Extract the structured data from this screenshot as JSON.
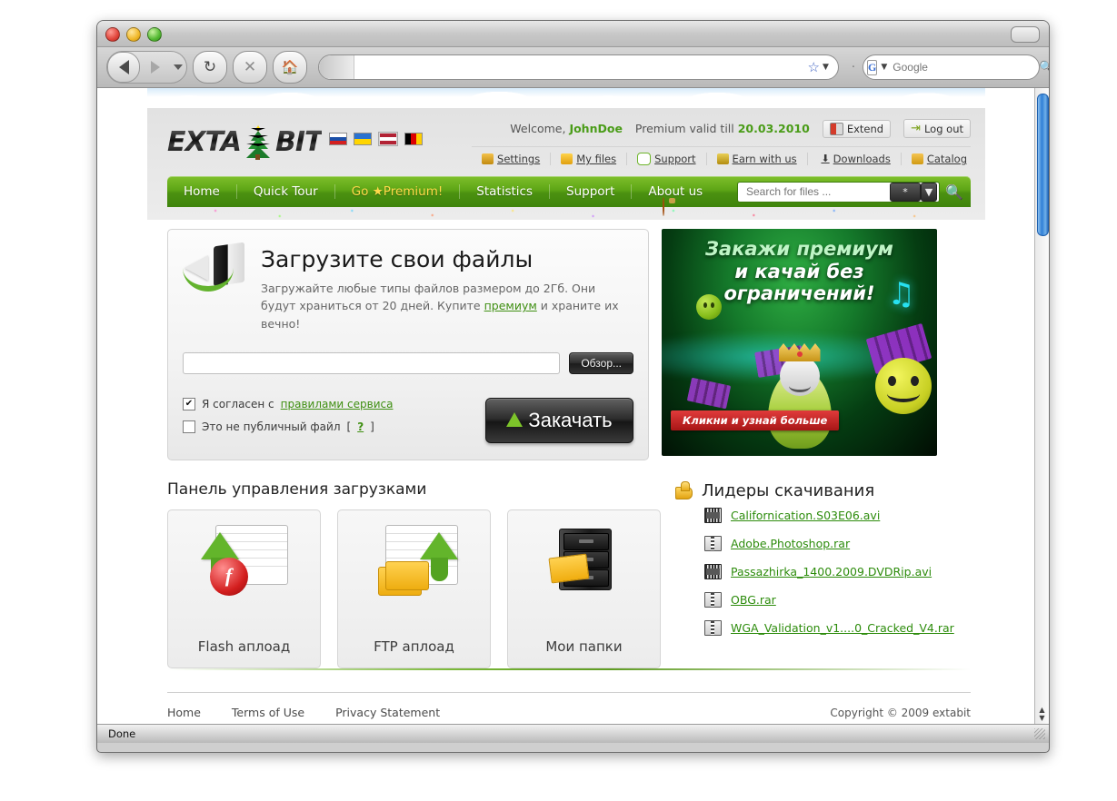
{
  "browser": {
    "url_value": "",
    "url_placeholder": "",
    "search_value": "Google",
    "search_placeholder": "Google",
    "search_engine_letter": "G",
    "status_text": "Done",
    "buttons": {
      "back": "back-button",
      "forward": "forward-button",
      "reload": "↻",
      "stop": "×",
      "home": "⌂"
    }
  },
  "header": {
    "logo_text_left": "EXTA",
    "logo_text_right": "BIT",
    "languages": [
      {
        "name": "russian",
        "colors": [
          "#ffffff",
          "#1b4fa8",
          "#d41f1f"
        ]
      },
      {
        "name": "ukrainian",
        "colors": [
          "#2a72d0",
          "#2a72d0",
          "#ffd500"
        ]
      },
      {
        "name": "english",
        "colors": [
          "#b22234",
          "#ffffff",
          "#3c3b6e"
        ]
      },
      {
        "name": "german",
        "colors": [
          "#000000",
          "#dd0000",
          "#ffce00"
        ]
      }
    ],
    "welcome_label": "Welcome,",
    "username": "JohnDoe",
    "premium_label": "Premium valid till",
    "premium_date": "20.03.2010",
    "extend_label": "Extend",
    "logout_label": "Log out",
    "sublinks": [
      {
        "label": "Settings",
        "icon": "settings-icon"
      },
      {
        "label": "My files",
        "icon": "star-folder-icon"
      },
      {
        "label": "Support",
        "icon": "chat-bubble-icon"
      },
      {
        "label": "Earn with us",
        "icon": "money-bag-icon"
      },
      {
        "label": "Downloads",
        "icon": "download-arrow-icon"
      },
      {
        "label": "Catalog",
        "icon": "folder-icon"
      }
    ]
  },
  "nav": {
    "items": [
      {
        "label": "Home"
      },
      {
        "label": "Quick Tour"
      },
      {
        "label": "Go ★Premium!",
        "highlight": true
      },
      {
        "label": "Statistics"
      },
      {
        "label": "Support"
      },
      {
        "label": "About us"
      }
    ],
    "search_placeholder": "Search for files ...",
    "search_value": "",
    "filter_label": "*",
    "search_icon": "magnifier-icon"
  },
  "upload": {
    "title": "Загрузите свои файлы",
    "desc_part1": "Загружайте любые типы файлов размером до 2Гб. Они будут храниться от 20 дней. Купите",
    "desc_link": "премиум",
    "desc_part2": "и храните их вечно!",
    "file_value": "",
    "browse_label": "Обзор...",
    "agree_prefix": "Я согласен с",
    "agree_link": "правилами сервиса",
    "agree_checked": "✔",
    "private_label": "Это не публичный файл",
    "private_help_open": "[",
    "private_help": "?",
    "private_help_close": "]",
    "submit_label": "Закачать"
  },
  "banner": {
    "line1": "Закажи премиум",
    "line2": "и качай без ограничений!",
    "cta": "Кликни и узнай больше",
    "music_note": "♫"
  },
  "panel": {
    "title": "Панель управления загрузками",
    "cards": [
      {
        "label": "Flash аплоад",
        "icon": "flash-upload-icon"
      },
      {
        "label": "FTP аплоад",
        "icon": "ftp-upload-icon"
      },
      {
        "label": "Мои папки",
        "icon": "file-cabinet-icon"
      }
    ]
  },
  "leaders": {
    "title": "Лидеры скачивания",
    "icon": "thumbs-up-icon",
    "files": [
      {
        "name": "Californication.S03E06.avi",
        "type": "video"
      },
      {
        "name": "Adobe.Photoshop.rar",
        "type": "archive"
      },
      {
        "name": "Passazhirka_1400.2009.DVDRip.avi",
        "type": "video"
      },
      {
        "name": "OBG.rar",
        "type": "archive"
      },
      {
        "name": "WGA_Validation_v1....0_Cracked_V4.rar",
        "type": "archive"
      }
    ]
  },
  "footer": {
    "links": [
      "Home",
      "Terms of Use",
      "Privacy Statement"
    ],
    "copyright": "Copyright © 2009 extabit"
  }
}
